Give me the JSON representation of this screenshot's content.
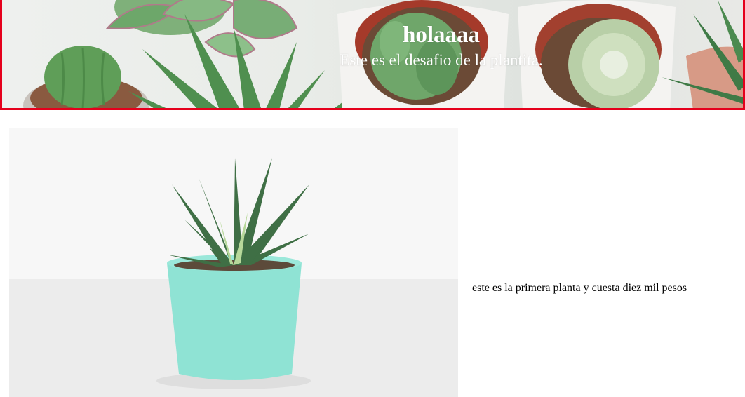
{
  "header": {
    "title": "holaaaa",
    "subtitle": "Este es el desafio de la plantita."
  },
  "products": [
    {
      "description": "este es la primera planta y cuesta diez mil pesos",
      "pot_color": "#8fe3d4",
      "plant_color": "#3f6f45"
    }
  ],
  "colors": {
    "header_border": "#e5001c",
    "header_text": "#ffffff",
    "body_text": "#000000"
  }
}
